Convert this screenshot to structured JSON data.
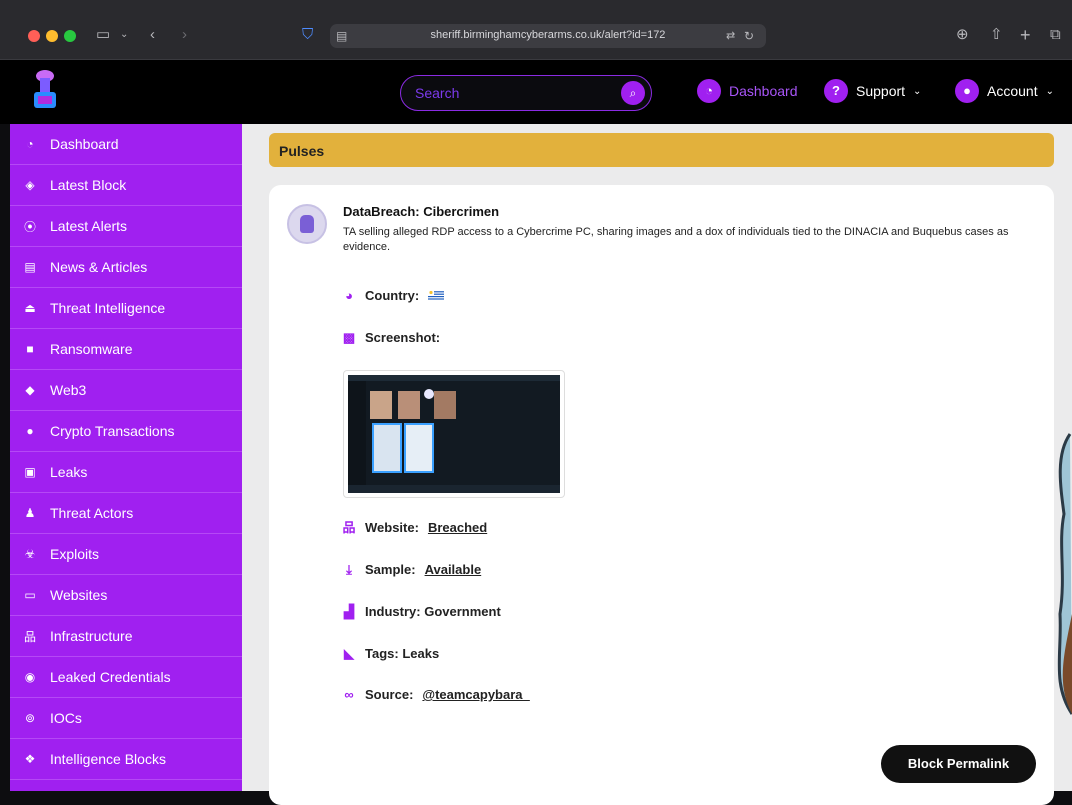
{
  "browser": {
    "url": "sheriff.birminghamcyberarms.co.uk/alert?id=172"
  },
  "header": {
    "search_placeholder": "Search",
    "nav": [
      {
        "label": "Dashboard",
        "icon": "dashboard-icon"
      },
      {
        "label": "Support",
        "icon": "question-icon"
      },
      {
        "label": "Account",
        "icon": "user-icon"
      }
    ]
  },
  "sidebar": {
    "items": [
      {
        "label": "Dashboard",
        "icon": "gauge-icon"
      },
      {
        "label": "Latest Block",
        "icon": "cube-icon"
      },
      {
        "label": "Latest Alerts",
        "icon": "broadcast-icon"
      },
      {
        "label": "News & Articles",
        "icon": "newspaper-icon"
      },
      {
        "label": "Threat Intelligence",
        "icon": "landmark-icon"
      },
      {
        "label": "Ransomware",
        "icon": "lock-icon"
      },
      {
        "label": "Web3",
        "icon": "ethereum-icon"
      },
      {
        "label": "Crypto Transactions",
        "icon": "bitcoin-icon"
      },
      {
        "label": "Leaks",
        "icon": "drive-icon"
      },
      {
        "label": "Threat Actors",
        "icon": "user-secret-icon"
      },
      {
        "label": "Exploits",
        "icon": "biohazard-icon"
      },
      {
        "label": "Websites",
        "icon": "laptop-code-icon"
      },
      {
        "label": "Infrastructure",
        "icon": "sitemap-icon"
      },
      {
        "label": "Leaked Credentials",
        "icon": "eye-icon"
      },
      {
        "label": "IOCs",
        "icon": "fingerprint-icon"
      },
      {
        "label": "Intelligence Blocks",
        "icon": "cubes-icon"
      }
    ]
  },
  "main": {
    "section_title": "Pulses",
    "alert": {
      "title": "DataBreach: Cibercrimen",
      "description": "TA selling alleged RDP access to a Cybercrime PC, sharing images and a dox of individuals tied to the DINACIA and Buquebus cases as evidence.",
      "country_label": "Country:",
      "screenshot_label": "Screenshot:",
      "website_label": "Website:",
      "website_value": "Breached",
      "sample_label": "Sample:",
      "sample_value": "Available",
      "industry_label": "Industry: Government",
      "tags_label": "Tags: Leaks",
      "source_label": "Source:",
      "source_value": "@teamcapybara_"
    },
    "permalink_label": "Block Permalink"
  },
  "colors": {
    "accent": "#a020f0",
    "pulses_bar": "#e2b13c"
  }
}
